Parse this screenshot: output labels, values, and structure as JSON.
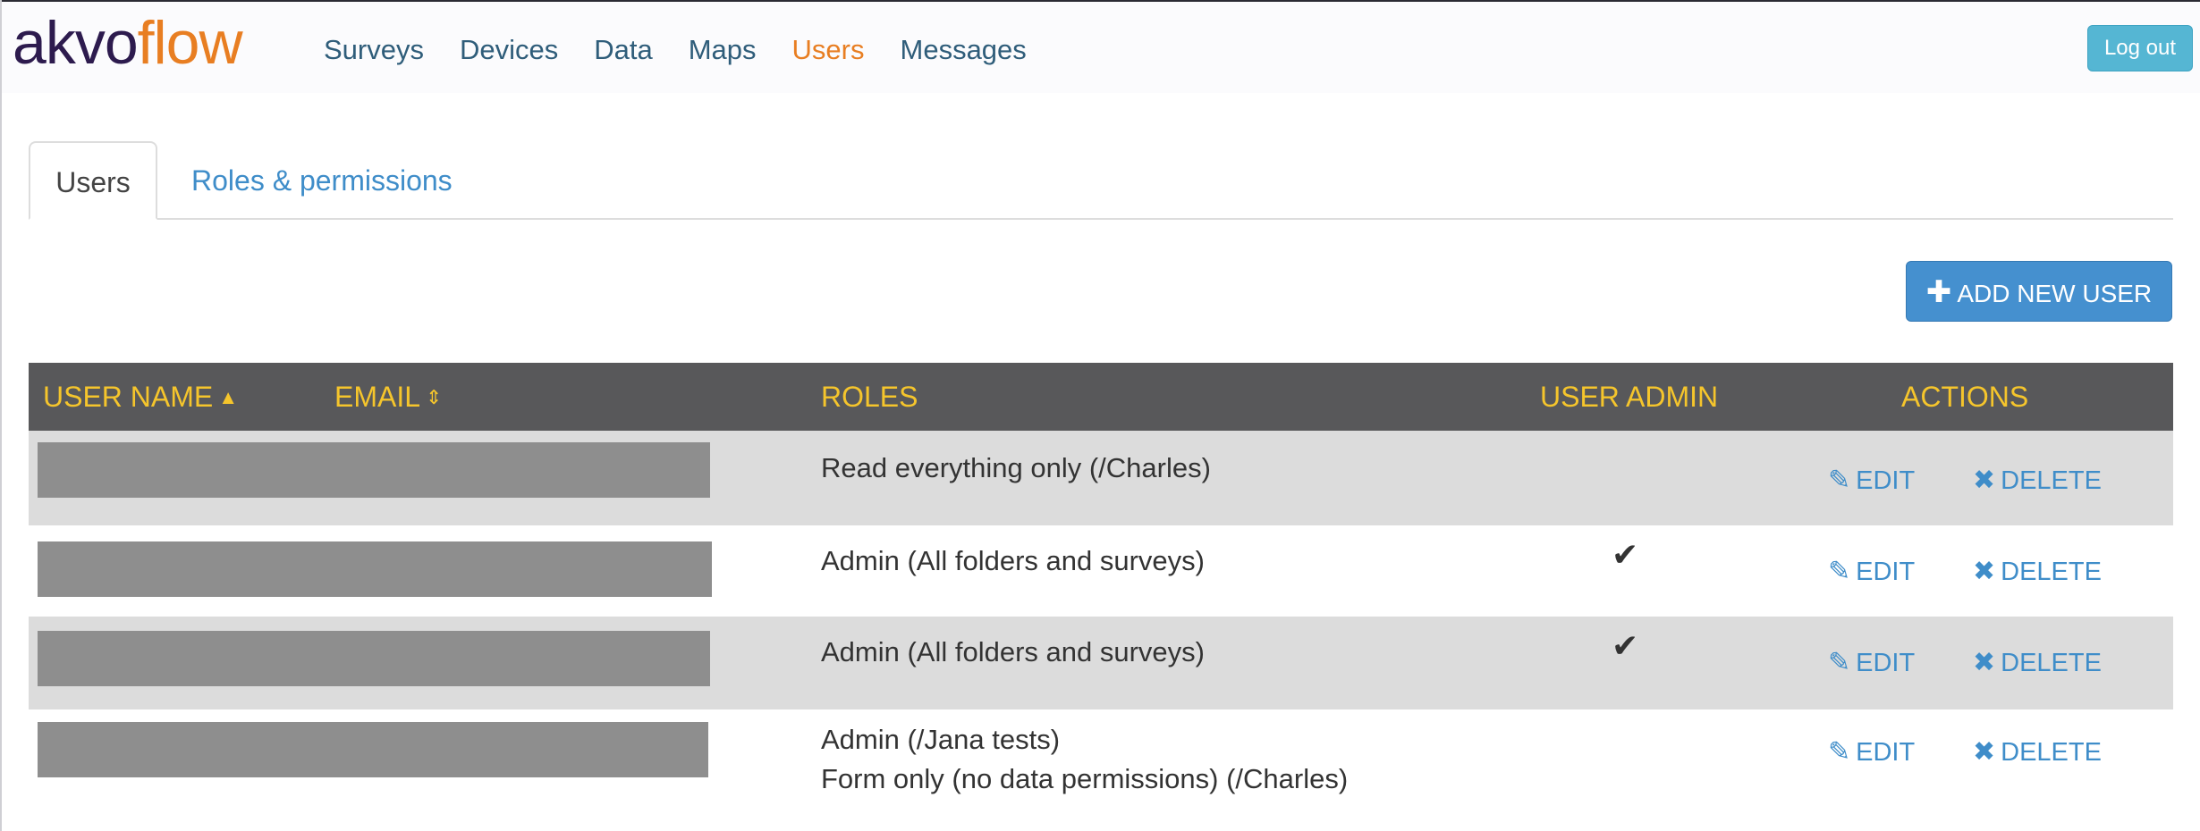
{
  "app": {
    "logo_part1": "akvo",
    "logo_part2": "flow"
  },
  "nav": {
    "items": [
      "Surveys",
      "Devices",
      "Data",
      "Maps",
      "Users",
      "Messages"
    ],
    "active": "Users"
  },
  "header": {
    "logout_label": "Log out"
  },
  "tabs": [
    {
      "label": "Users",
      "active": true
    },
    {
      "label": "Roles & permissions",
      "active": false
    }
  ],
  "add_button": {
    "icon": "plus-icon",
    "label": "ADD NEW USER"
  },
  "table": {
    "columns": {
      "username": "USER NAME",
      "email": "EMAIL",
      "roles": "ROLES",
      "user_admin": "USER ADMIN",
      "actions": "ACTIONS"
    },
    "sort_icons": {
      "username": "caret-up-icon",
      "email": "sort-icon"
    },
    "edit_label": "EDIT",
    "delete_label": "DELETE",
    "rows": [
      {
        "roles": [
          "Read everything only (/Charles)"
        ],
        "user_admin": false
      },
      {
        "roles": [
          "Admin (All folders and surveys)"
        ],
        "user_admin": true
      },
      {
        "roles": [
          "Admin (All folders and surveys)"
        ],
        "user_admin": true
      },
      {
        "roles": [
          "Admin (/Jana tests)",
          "Form only (no data permissions) (/Charles)"
        ],
        "user_admin": false
      }
    ]
  },
  "colors": {
    "brand_dark": "#2d1b4e",
    "brand_orange": "#e87e22",
    "nav_text": "#2f5d7a",
    "link_blue": "#3f8dc9",
    "header_bg": "#58585a",
    "header_text": "#f5c52c",
    "logout_bg": "#55b6d3",
    "add_button_bg": "#4590cf"
  }
}
